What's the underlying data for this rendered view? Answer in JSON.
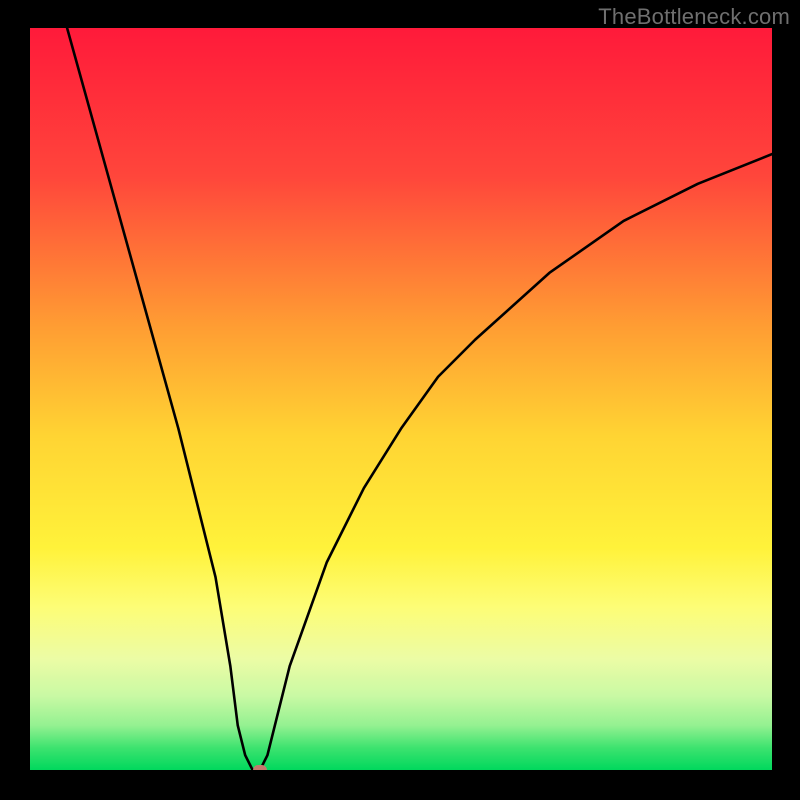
{
  "watermark": "TheBottleneck.com",
  "chart_data": {
    "type": "line",
    "title": "",
    "xlabel": "",
    "ylabel": "",
    "xlim": [
      0,
      100
    ],
    "ylim": [
      0,
      100
    ],
    "grid": false,
    "legend": false,
    "series": [
      {
        "name": "curve",
        "x": [
          5,
          10,
          15,
          20,
          25,
          27,
          28,
          29,
          30,
          31,
          32,
          33,
          35,
          40,
          45,
          50,
          55,
          60,
          70,
          80,
          90,
          100
        ],
        "y": [
          100,
          82,
          64,
          46,
          26,
          14,
          6,
          2,
          0,
          0,
          2,
          6,
          14,
          28,
          38,
          46,
          53,
          58,
          67,
          74,
          79,
          83
        ]
      }
    ],
    "marker": {
      "x": 31,
      "y": 0,
      "color": "#c27a6e"
    },
    "gradient_stops": [
      {
        "offset": 0,
        "color": "#ff1a3a"
      },
      {
        "offset": 20,
        "color": "#ff463b"
      },
      {
        "offset": 40,
        "color": "#ff9c33"
      },
      {
        "offset": 55,
        "color": "#ffd433"
      },
      {
        "offset": 70,
        "color": "#fff23a"
      },
      {
        "offset": 78,
        "color": "#fdfd76"
      },
      {
        "offset": 85,
        "color": "#ecfca5"
      },
      {
        "offset": 90,
        "color": "#c9f9a4"
      },
      {
        "offset": 94,
        "color": "#94f191"
      },
      {
        "offset": 97,
        "color": "#3de36f"
      },
      {
        "offset": 100,
        "color": "#00d85d"
      }
    ]
  }
}
